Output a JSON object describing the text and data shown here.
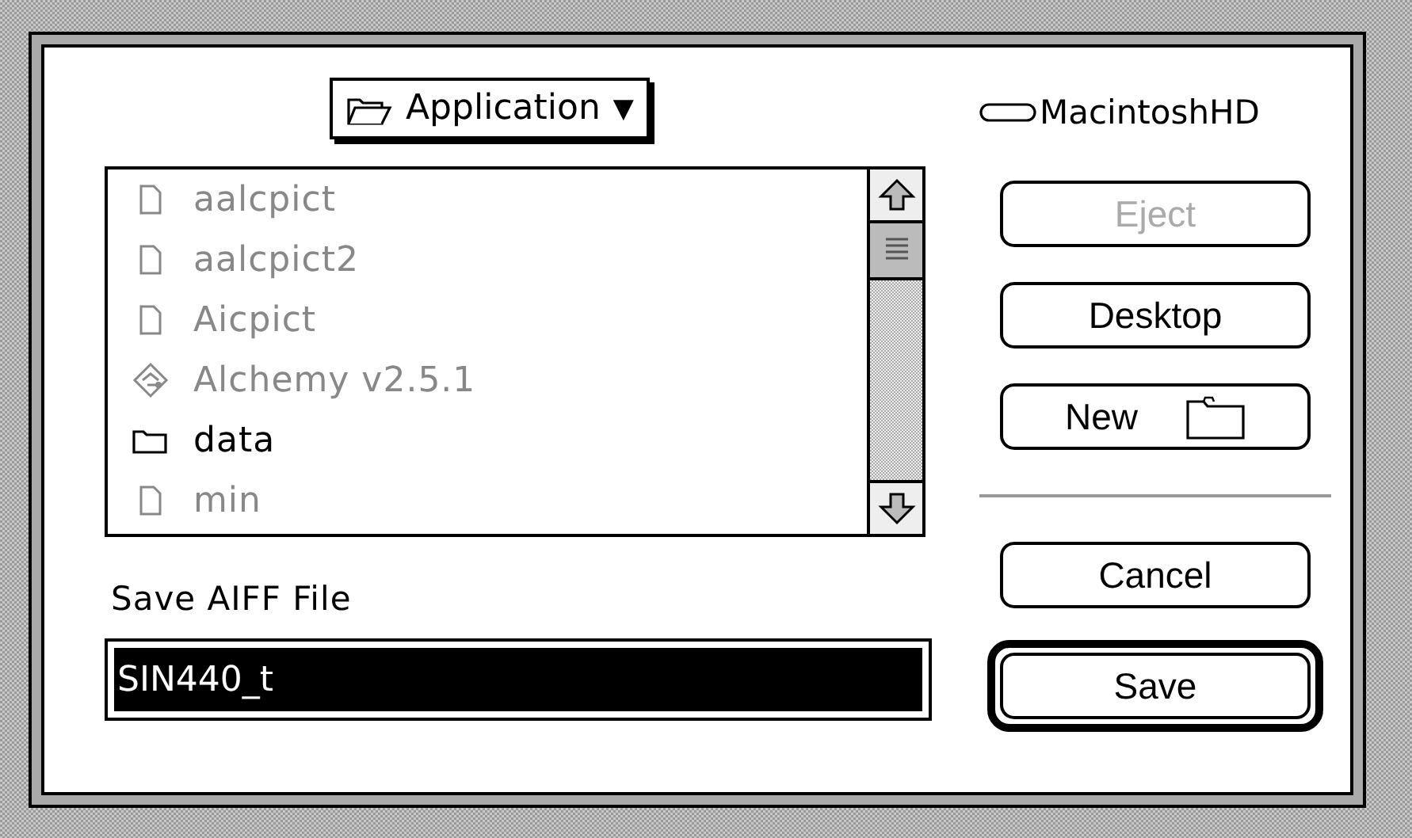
{
  "folder_popup": {
    "label": "Application",
    "arrow": "▼"
  },
  "disk": {
    "label": "MacintoshHD"
  },
  "files": [
    {
      "name": "aalcpict",
      "kind": "document",
      "disabled": true
    },
    {
      "name": "aalcpict2",
      "kind": "document",
      "disabled": true
    },
    {
      "name": "Aicpict",
      "kind": "document",
      "disabled": true
    },
    {
      "name": "Alchemy v2.5.1",
      "kind": "application",
      "disabled": true
    },
    {
      "name": "data",
      "kind": "folder",
      "disabled": false
    },
    {
      "name": "min",
      "kind": "document",
      "disabled": true
    }
  ],
  "prompt": "Save AIFF File",
  "filename_field": {
    "value": "SIN440_t",
    "selected": true
  },
  "buttons": [
    {
      "label": "Eject",
      "kind": "plain",
      "disabled": true,
      "default": false
    },
    {
      "label": "Desktop",
      "kind": "plain",
      "disabled": false,
      "default": false
    },
    {
      "label": "New",
      "kind": "folder",
      "disabled": false,
      "default": false
    },
    {
      "kind": "divider"
    },
    {
      "label": "Cancel",
      "kind": "plain",
      "disabled": false,
      "default": false
    },
    {
      "label": "Save",
      "kind": "plain",
      "disabled": false,
      "default": true
    }
  ]
}
